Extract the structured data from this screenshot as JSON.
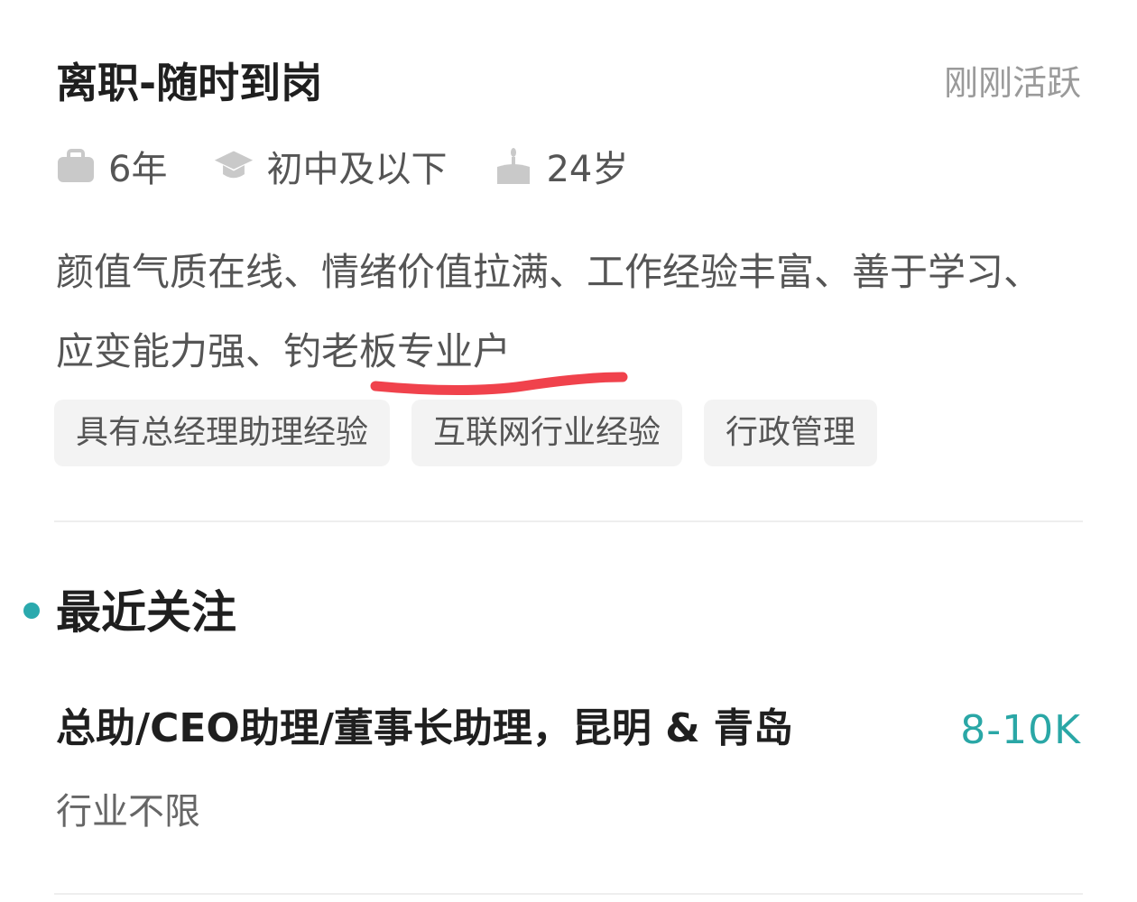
{
  "profile": {
    "status": "离职-随时到岗",
    "activity": "刚刚活跃",
    "experience": "6年",
    "education": "初中及以下",
    "age": "24岁",
    "description_main": "颜值气质在线、情绪价值拉满、工作经验丰富、善于学习、应变能力强、",
    "description_highlight": "钓老板专业户",
    "tags": [
      "具有总经理助理经验",
      "互联网行业经验",
      "行政管理"
    ],
    "icons": {
      "experience": "briefcase-icon",
      "education": "graduation-cap-icon",
      "age": "birthday-cake-icon"
    }
  },
  "recent_focus": {
    "title": "最近关注",
    "job_title": "总助/CEO助理/董事长助理，昆明 & 青岛",
    "salary": "8-10K",
    "industry": "行业不限"
  },
  "colors": {
    "accent": "#2aa7a6",
    "annotation": "#f0424c",
    "muted_text": "#9a9a9a",
    "tag_bg": "#f3f3f3"
  }
}
